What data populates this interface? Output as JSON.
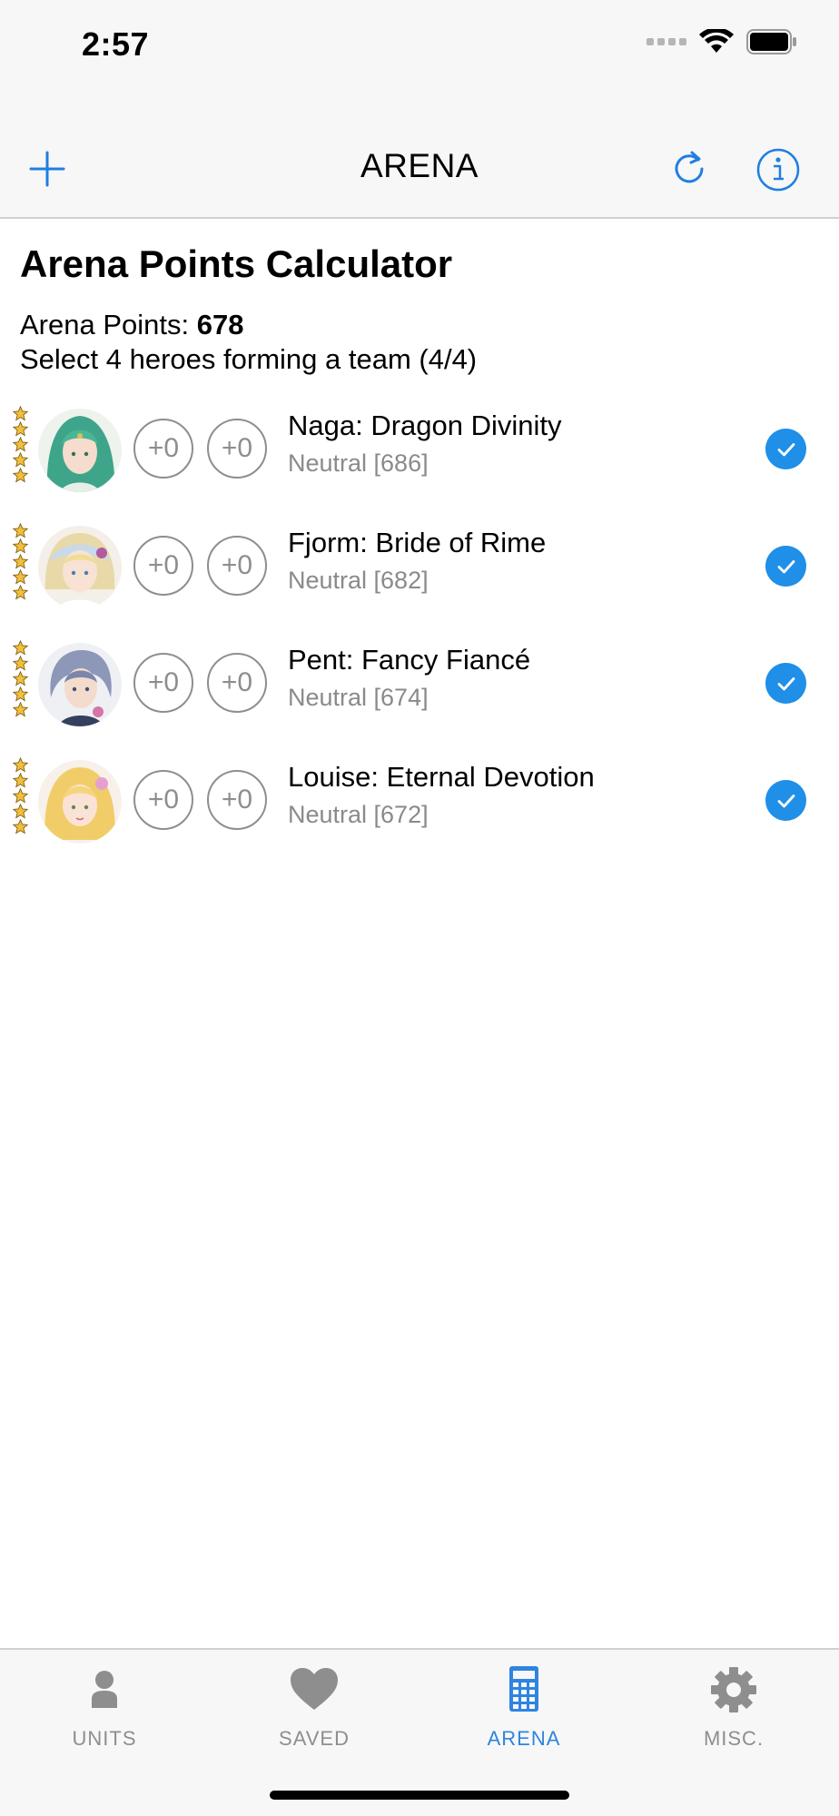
{
  "status": {
    "time": "2:57"
  },
  "nav": {
    "title": "ARENA"
  },
  "colors": {
    "accent": "#1f8fe8",
    "tab_active": "#2f84e0",
    "inactive": "#8e8e8e"
  },
  "page": {
    "title": "Arena Points Calculator",
    "points_label": "Arena Points: ",
    "points_value": "678",
    "select_text": "Select 4 heroes forming a team (4/4)"
  },
  "heroes": [
    {
      "name": "Naga: Dragon Divinity",
      "subtitle": "Neutral [686]",
      "merge1": "+0",
      "merge2": "+0",
      "rarity": 5,
      "selected": true
    },
    {
      "name": "Fjorm: Bride of Rime",
      "subtitle": "Neutral [682]",
      "merge1": "+0",
      "merge2": "+0",
      "rarity": 5,
      "selected": true
    },
    {
      "name": "Pent: Fancy Fiancé",
      "subtitle": "Neutral [674]",
      "merge1": "+0",
      "merge2": "+0",
      "rarity": 5,
      "selected": true
    },
    {
      "name": "Louise: Eternal Devotion",
      "subtitle": "Neutral [672]",
      "merge1": "+0",
      "merge2": "+0",
      "rarity": 5,
      "selected": true
    }
  ],
  "tabs": [
    {
      "label": "UNITS",
      "icon": "person-icon",
      "active": false
    },
    {
      "label": "SAVED",
      "icon": "heart-icon",
      "active": false
    },
    {
      "label": "ARENA",
      "icon": "calculator-icon",
      "active": true
    },
    {
      "label": "MISC.",
      "icon": "gear-icon",
      "active": false
    }
  ]
}
